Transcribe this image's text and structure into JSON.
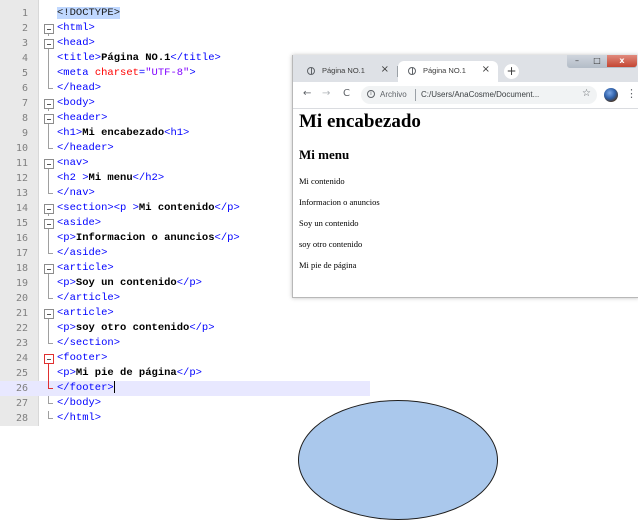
{
  "editor": {
    "lines": [
      {
        "n": "1",
        "parts": [
          [
            "hl",
            "<!DOCTYPE>"
          ]
        ]
      },
      {
        "n": "2",
        "parts": [
          [
            "tag",
            "<html>"
          ]
        ]
      },
      {
        "n": "3",
        "parts": [
          [
            "tag",
            "<head>"
          ]
        ]
      },
      {
        "n": "4",
        "parts": [
          [
            "tag",
            "<title>"
          ],
          [
            "txt",
            "Página NO.1"
          ],
          [
            "tag",
            "</title>"
          ]
        ]
      },
      {
        "n": "5",
        "parts": [
          [
            "tag",
            "<meta "
          ],
          [
            "attr",
            "charset"
          ],
          [
            "tag",
            "="
          ],
          [
            "val",
            "\"UTF-8\""
          ],
          [
            "tag",
            ">"
          ]
        ]
      },
      {
        "n": "6",
        "parts": [
          [
            "tag",
            "</head>"
          ]
        ]
      },
      {
        "n": "7",
        "parts": [
          [
            "tag",
            "<body>"
          ]
        ]
      },
      {
        "n": "8",
        "parts": [
          [
            "tag",
            "<header>"
          ]
        ]
      },
      {
        "n": "9",
        "parts": [
          [
            "tag",
            "<h1>"
          ],
          [
            "txt",
            "Mi encabezado"
          ],
          [
            "tag",
            "<h1>"
          ]
        ]
      },
      {
        "n": "10",
        "parts": [
          [
            "tag",
            "</header>"
          ]
        ]
      },
      {
        "n": "11",
        "parts": [
          [
            "tag",
            "<nav>"
          ]
        ]
      },
      {
        "n": "12",
        "parts": [
          [
            "tag",
            "<h2 >"
          ],
          [
            "txt",
            "Mi menu"
          ],
          [
            "tag",
            "</h2>"
          ]
        ]
      },
      {
        "n": "13",
        "parts": [
          [
            "tag",
            "</nav>"
          ]
        ]
      },
      {
        "n": "14",
        "parts": [
          [
            "tag",
            "<section><p >"
          ],
          [
            "txt",
            "Mi contenido"
          ],
          [
            "tag",
            "</p>"
          ]
        ]
      },
      {
        "n": "15",
        "parts": [
          [
            "tag",
            "<aside>"
          ]
        ]
      },
      {
        "n": "16",
        "parts": [
          [
            "tag",
            "<p>"
          ],
          [
            "txt",
            "Informacion o anuncios"
          ],
          [
            "tag",
            "</p>"
          ]
        ]
      },
      {
        "n": "17",
        "parts": [
          [
            "tag",
            "</aside>"
          ]
        ]
      },
      {
        "n": "18",
        "parts": [
          [
            "tag",
            "<article>"
          ]
        ]
      },
      {
        "n": "19",
        "parts": [
          [
            "tag",
            "<p>"
          ],
          [
            "txt",
            "Soy un contenido"
          ],
          [
            "tag",
            "</p>"
          ]
        ]
      },
      {
        "n": "20",
        "parts": [
          [
            "tag",
            "</article>"
          ]
        ]
      },
      {
        "n": "21",
        "parts": [
          [
            "tag",
            "<article>"
          ]
        ]
      },
      {
        "n": "22",
        "parts": [
          [
            "tag",
            "<p>"
          ],
          [
            "txt",
            "soy otro contenido"
          ],
          [
            "tag",
            "</p>"
          ]
        ]
      },
      {
        "n": "23",
        "parts": [
          [
            "tag",
            "</section>"
          ]
        ]
      },
      {
        "n": "24",
        "parts": [
          [
            "tag",
            "<footer>"
          ]
        ]
      },
      {
        "n": "25",
        "parts": [
          [
            "tag",
            "<p>"
          ],
          [
            "txt",
            "Mi pie de página"
          ],
          [
            "tag",
            "</p>"
          ]
        ]
      },
      {
        "n": "26",
        "parts": [
          [
            "tag",
            "</footer>"
          ]
        ]
      },
      {
        "n": "27",
        "parts": [
          [
            "tag",
            "</body>"
          ]
        ]
      },
      {
        "n": "28",
        "parts": [
          [
            "tag",
            "</html>"
          ]
        ]
      }
    ],
    "current_line": "26"
  },
  "browser": {
    "tabs": [
      {
        "title": "Página NO.1",
        "close": "×",
        "active": false
      },
      {
        "title": "Página NO.1",
        "close": "×",
        "active": true
      }
    ],
    "new_tab": "+",
    "window_controls": {
      "minimize": "–",
      "maximize": "□",
      "close": "x"
    },
    "nav": {
      "back": "←",
      "forward": "→",
      "reload": "C"
    },
    "address": {
      "info": "i",
      "chip": "Archivo",
      "url": "C:/Users/AnaCosme/Document...",
      "star": "☆"
    },
    "menu": "⋮",
    "page": {
      "h1": "Mi encabezado",
      "h2": "Mi menu",
      "paragraphs": [
        "Mi contenido",
        "Informacion o anuncios",
        "Soy un contenido",
        "soy otro contenido",
        "Mi pie de página"
      ]
    }
  }
}
